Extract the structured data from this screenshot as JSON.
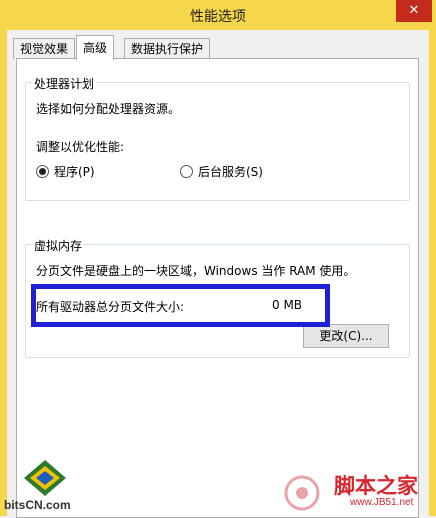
{
  "window": {
    "title": "性能选项",
    "close_glyph": "✕"
  },
  "tabs": [
    {
      "label": "视觉效果",
      "active": false
    },
    {
      "label": "高级",
      "active": true
    },
    {
      "label": "数据执行保护",
      "active": false
    }
  ],
  "processor": {
    "legend": "处理器计划",
    "description": "选择如何分配处理器资源。",
    "adjust_label": "调整以优化性能:",
    "option_programs": "程序(P)",
    "option_background": "后台服务(S)",
    "selected": "programs"
  },
  "virtual_memory": {
    "legend": "虚拟内存",
    "description": "分页文件是硬盘上的一块区域，Windows 当作 RAM 使用。",
    "total_label": "所有驱动器总分页文件大小:",
    "total_value": "0 MB",
    "change_button": "更改(C)..."
  },
  "watermarks": {
    "left_site": "bitsCN.com",
    "right_title": "脚本之家",
    "right_url": "www.JB51.net"
  },
  "colors": {
    "titlebar": "#f6d64a",
    "highlight": "#1f1fd6",
    "close": "#c42b1c",
    "brand_red": "#d7262d"
  }
}
